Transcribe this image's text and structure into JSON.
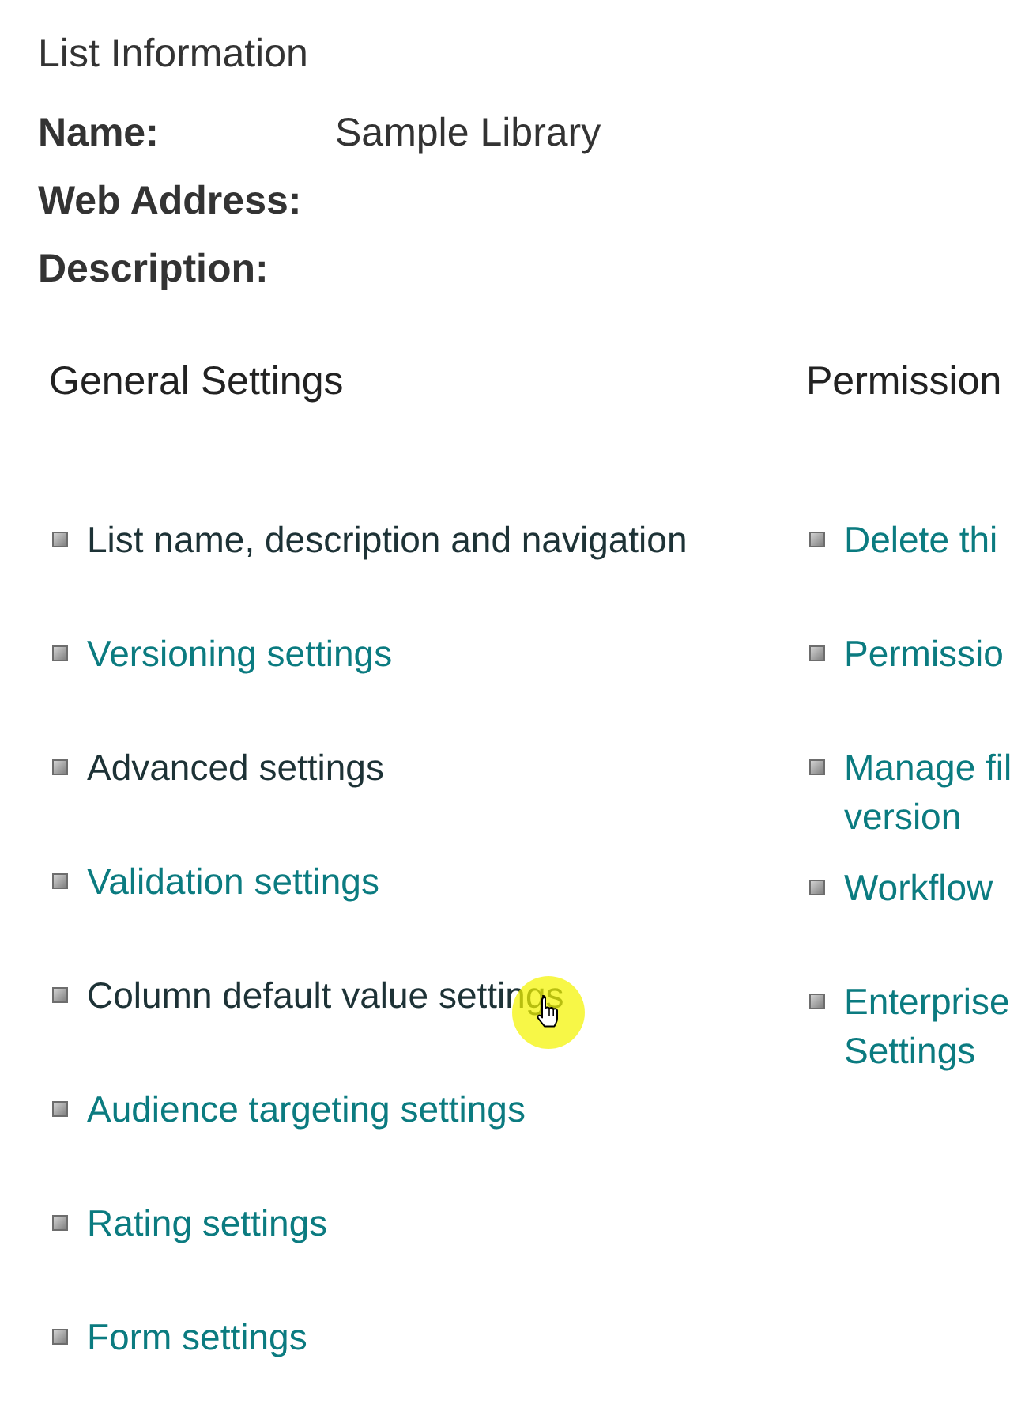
{
  "section_title": "List Information",
  "info_fields": [
    {
      "label": "Name:",
      "value": "Sample Library"
    },
    {
      "label": "Web Address:"
    },
    {
      "label": "Description:"
    }
  ],
  "columns": [
    {
      "heading": "General Settings",
      "items": [
        {
          "lines": [
            "List name, description and navigation"
          ],
          "visited": true,
          "hovered": false
        },
        {
          "lines": [
            "Versioning settings"
          ],
          "visited": false,
          "hovered": false
        },
        {
          "lines": [
            "Advanced settings"
          ],
          "visited": true,
          "hovered": false
        },
        {
          "lines": [
            "Validation settings"
          ],
          "visited": false,
          "hovered": false
        },
        {
          "lines": [
            "Column default value settings"
          ],
          "visited": true,
          "hovered": true
        },
        {
          "lines": [
            "Audience targeting settings"
          ],
          "visited": false,
          "hovered": false
        },
        {
          "lines": [
            "Rating settings"
          ],
          "visited": false,
          "hovered": false
        },
        {
          "lines": [
            "Form settings"
          ],
          "visited": false,
          "hovered": false
        }
      ]
    },
    {
      "heading": "Permission",
      "items": [
        {
          "lines": [
            "Delete thi"
          ],
          "visited": false,
          "hovered": false
        },
        {
          "lines": [
            "Permissio"
          ],
          "visited": false,
          "hovered": false
        },
        {
          "lines": [
            "Manage fil",
            "version"
          ],
          "visited": false,
          "hovered": false
        },
        {
          "lines": [
            "Workflow"
          ],
          "visited": false,
          "hovered": false
        },
        {
          "lines": [
            "Enterprise",
            "Settings"
          ],
          "visited": false,
          "hovered": false
        }
      ]
    }
  ]
}
